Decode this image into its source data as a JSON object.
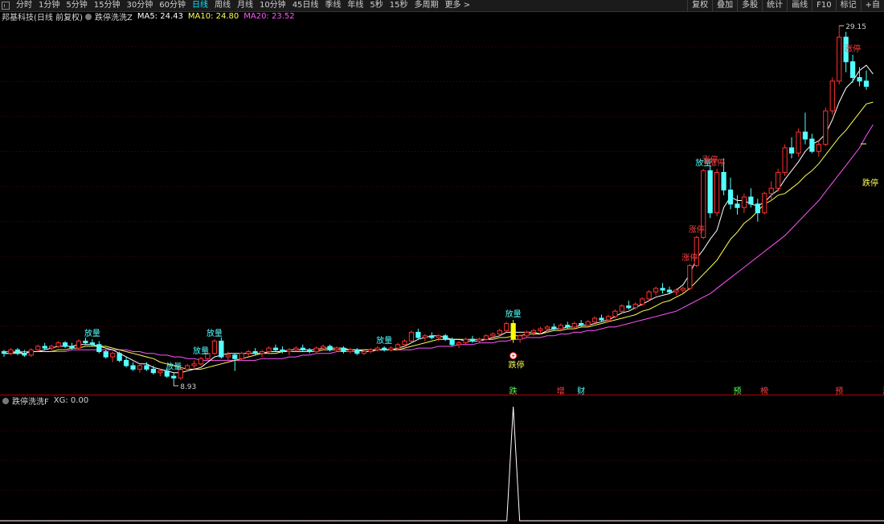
{
  "toolbar": {
    "periods": [
      "分时",
      "1分钟",
      "5分钟",
      "15分钟",
      "30分钟",
      "60分钟",
      "日线",
      "周线",
      "月线",
      "10分钟",
      "45日线",
      "季线",
      "年线",
      "5秒",
      "15秒",
      "多周期",
      "更多 >"
    ],
    "active_period": "日线",
    "right_buttons": [
      "复权",
      "叠加",
      "多股",
      "统计",
      "画线",
      "F10",
      "标记",
      "+自"
    ]
  },
  "main_legend": {
    "stock": "邦基科技(日线 前复权)",
    "indicator": "跌停洗洗Z",
    "ma5": "MA5: 24.43",
    "ma10": "MA10: 24.80",
    "ma20": "MA20: 23.52"
  },
  "sub_legend": {
    "indicator": "跌停洗洗F",
    "xg": "XG: 0.00"
  },
  "colors": {
    "up": "#ff3030",
    "down": "#54ffff",
    "ma5": "#ffffff",
    "ma10": "#ffff54",
    "ma20": "#ff54ff",
    "label_up": "#ff4040",
    "label_vol": "#54ffff",
    "label_drop": "#ffff54",
    "grid": "#5a0000"
  },
  "chart_data": {
    "type": "candlestick",
    "price_high_label": "29.15",
    "price_low_label": "8.93",
    "right_marker_text": "跌停",
    "candles": [
      [
        10.6,
        10.7,
        10.3,
        10.5
      ],
      [
        10.5,
        10.8,
        10.4,
        10.7
      ],
      [
        10.7,
        10.8,
        10.4,
        10.5
      ],
      [
        10.5,
        10.7,
        10.3,
        10.4
      ],
      [
        10.4,
        10.8,
        10.3,
        10.7
      ],
      [
        10.7,
        11.0,
        10.6,
        10.9
      ],
      [
        10.9,
        11.1,
        10.7,
        10.8
      ],
      [
        10.8,
        11.0,
        10.6,
        10.9
      ],
      [
        10.9,
        11.2,
        10.8,
        11.1
      ],
      [
        11.1,
        11.2,
        10.8,
        10.9
      ],
      [
        10.9,
        11.1,
        10.7,
        10.8
      ],
      [
        10.8,
        11.3,
        10.7,
        11.2
      ],
      [
        11.2,
        11.4,
        11.0,
        11.1
      ],
      [
        11.1,
        11.3,
        10.9,
        11.0
      ],
      [
        11.0,
        11.2,
        10.5,
        10.6
      ],
      [
        10.6,
        10.7,
        10.2,
        10.3
      ],
      [
        10.3,
        10.6,
        10.0,
        10.5
      ],
      [
        10.5,
        10.6,
        10.0,
        10.1
      ],
      [
        10.1,
        10.3,
        9.7,
        9.8
      ],
      [
        9.8,
        10.0,
        9.5,
        9.6
      ],
      [
        9.6,
        9.9,
        9.4,
        9.8
      ],
      [
        9.8,
        10.0,
        9.5,
        9.6
      ],
      [
        9.6,
        9.8,
        9.3,
        9.4
      ],
      [
        9.4,
        9.6,
        9.2,
        9.5
      ],
      [
        9.5,
        9.7,
        9.1,
        9.2
      ],
      [
        9.2,
        9.4,
        8.93,
        9.1
      ],
      [
        9.1,
        9.7,
        9.0,
        9.6
      ],
      [
        9.6,
        9.9,
        9.5,
        9.8
      ],
      [
        9.8,
        10.1,
        9.6,
        9.9
      ],
      [
        9.9,
        10.3,
        9.8,
        10.2
      ],
      [
        10.2,
        10.6,
        10.1,
        10.5
      ],
      [
        10.5,
        11.3,
        10.4,
        11.2
      ],
      [
        11.2,
        11.4,
        10.2,
        10.3
      ],
      [
        10.3,
        10.6,
        10.0,
        10.4
      ],
      [
        10.4,
        10.5,
        9.5,
        10.2
      ],
      [
        10.2,
        10.6,
        10.1,
        10.5
      ],
      [
        10.5,
        10.7,
        10.3,
        10.6
      ],
      [
        10.6,
        10.8,
        10.4,
        10.5
      ],
      [
        10.5,
        10.7,
        10.3,
        10.6
      ],
      [
        10.6,
        10.9,
        10.5,
        10.8
      ],
      [
        10.8,
        11.0,
        10.6,
        10.7
      ],
      [
        10.7,
        10.9,
        10.5,
        10.6
      ],
      [
        10.6,
        10.8,
        10.4,
        10.7
      ],
      [
        10.7,
        10.9,
        10.6,
        10.8
      ],
      [
        10.8,
        11.0,
        10.6,
        10.7
      ],
      [
        10.7,
        10.8,
        10.5,
        10.6
      ],
      [
        10.6,
        10.9,
        10.5,
        10.8
      ],
      [
        10.8,
        11.0,
        10.7,
        10.9
      ],
      [
        10.9,
        11.0,
        10.6,
        10.7
      ],
      [
        10.7,
        10.9,
        10.6,
        10.8
      ],
      [
        10.8,
        10.9,
        10.5,
        10.6
      ],
      [
        10.6,
        10.8,
        10.5,
        10.7
      ],
      [
        10.7,
        10.8,
        10.4,
        10.5
      ],
      [
        10.5,
        10.7,
        10.4,
        10.6
      ],
      [
        10.6,
        10.8,
        10.5,
        10.7
      ],
      [
        10.7,
        10.9,
        10.6,
        10.8
      ],
      [
        10.8,
        10.9,
        10.6,
        10.7
      ],
      [
        10.7,
        10.9,
        10.6,
        10.8
      ],
      [
        10.8,
        11.1,
        10.7,
        11.0
      ],
      [
        11.0,
        11.3,
        10.9,
        11.2
      ],
      [
        11.2,
        11.8,
        11.1,
        11.7
      ],
      [
        11.7,
        11.9,
        11.3,
        11.4
      ],
      [
        11.4,
        11.6,
        11.2,
        11.5
      ],
      [
        11.5,
        11.7,
        11.3,
        11.4
      ],
      [
        11.4,
        11.6,
        11.2,
        11.5
      ],
      [
        11.5,
        11.6,
        11.2,
        11.3
      ],
      [
        11.3,
        11.4,
        10.9,
        11.0
      ],
      [
        11.0,
        11.2,
        10.8,
        11.1
      ],
      [
        11.1,
        11.4,
        11.0,
        11.3
      ],
      [
        11.3,
        11.5,
        11.1,
        11.2
      ],
      [
        11.2,
        11.4,
        11.1,
        11.3
      ],
      [
        11.3,
        11.6,
        11.2,
        11.5
      ],
      [
        11.5,
        11.7,
        11.3,
        11.6
      ],
      [
        11.6,
        11.9,
        11.5,
        11.8
      ],
      [
        11.8,
        12.3,
        11.7,
        12.2
      ],
      [
        12.2,
        12.4,
        11.1,
        11.3
      ],
      [
        11.3,
        11.6,
        11.1,
        11.5
      ],
      [
        11.5,
        11.8,
        11.4,
        11.7
      ],
      [
        11.7,
        11.9,
        11.5,
        11.8
      ],
      [
        11.8,
        12.0,
        11.6,
        11.9
      ],
      [
        11.9,
        12.1,
        11.7,
        12.0
      ],
      [
        12.0,
        12.2,
        11.8,
        11.9
      ],
      [
        11.9,
        12.2,
        11.8,
        12.1
      ],
      [
        12.1,
        12.3,
        11.9,
        12.0
      ],
      [
        12.0,
        12.3,
        11.9,
        12.2
      ],
      [
        12.2,
        12.4,
        12.0,
        12.1
      ],
      [
        12.1,
        12.4,
        12.0,
        12.3
      ],
      [
        12.3,
        12.6,
        12.2,
        12.5
      ],
      [
        12.5,
        12.7,
        12.3,
        12.4
      ],
      [
        12.4,
        12.7,
        12.3,
        12.6
      ],
      [
        12.6,
        13.0,
        12.5,
        12.9
      ],
      [
        12.9,
        13.3,
        12.8,
        13.2
      ],
      [
        13.2,
        13.5,
        13.0,
        13.1
      ],
      [
        13.1,
        13.4,
        13.0,
        13.3
      ],
      [
        13.3,
        13.7,
        13.2,
        13.6
      ],
      [
        13.6,
        14.1,
        13.5,
        14.0
      ],
      [
        14.0,
        14.3,
        13.8,
        14.2
      ],
      [
        14.2,
        14.5,
        13.9,
        14.1
      ],
      [
        14.1,
        14.3,
        13.9,
        14.0
      ],
      [
        14.0,
        14.2,
        13.8,
        14.1
      ],
      [
        14.1,
        14.3,
        13.9,
        14.2
      ],
      [
        14.2,
        15.6,
        14.1,
        15.5
      ],
      [
        15.5,
        17.2,
        15.4,
        17.1
      ],
      [
        17.1,
        21.0,
        17.0,
        20.9
      ],
      [
        20.9,
        21.2,
        18.2,
        18.5
      ],
      [
        18.5,
        21.0,
        18.3,
        20.8
      ],
      [
        20.8,
        21.6,
        19.5,
        19.8
      ],
      [
        19.8,
        20.5,
        18.7,
        19.0
      ],
      [
        19.0,
        19.5,
        18.4,
        18.8
      ],
      [
        18.8,
        19.6,
        18.5,
        19.4
      ],
      [
        19.4,
        19.9,
        18.8,
        19.0
      ],
      [
        19.0,
        19.3,
        18.0,
        18.5
      ],
      [
        18.5,
        19.7,
        18.4,
        19.6
      ],
      [
        19.6,
        20.3,
        19.2,
        19.9
      ],
      [
        19.9,
        21.0,
        19.7,
        20.8
      ],
      [
        20.8,
        22.4,
        20.6,
        22.2
      ],
      [
        22.2,
        22.8,
        21.6,
        21.9
      ],
      [
        21.9,
        23.3,
        21.7,
        23.1
      ],
      [
        23.1,
        24.2,
        22.4,
        22.7
      ],
      [
        22.7,
        23.0,
        21.9,
        22.0
      ],
      [
        22.0,
        22.6,
        21.7,
        22.4
      ],
      [
        22.4,
        24.5,
        22.3,
        24.3
      ],
      [
        24.3,
        26.2,
        24.1,
        26.0
      ],
      [
        26.0,
        29.15,
        25.8,
        28.5
      ],
      [
        28.5,
        28.8,
        26.5,
        27.1
      ],
      [
        27.1,
        27.5,
        25.9,
        26.2
      ],
      [
        26.2,
        26.8,
        25.7,
        26.0
      ],
      [
        26.0,
        26.6,
        25.5,
        25.7
      ]
    ],
    "ma5": [
      10.5,
      10.5,
      10.6,
      10.5,
      10.6,
      10.6,
      10.7,
      10.8,
      10.9,
      10.9,
      10.9,
      11.0,
      11.0,
      11.0,
      10.9,
      10.8,
      10.7,
      10.5,
      10.3,
      10.1,
      9.9,
      9.9,
      9.7,
      9.6,
      9.5,
      9.4,
      9.4,
      9.5,
      9.6,
      9.7,
      10.0,
      10.3,
      10.4,
      10.5,
      10.5,
      10.5,
      10.5,
      10.5,
      10.5,
      10.6,
      10.6,
      10.6,
      10.7,
      10.7,
      10.7,
      10.7,
      10.7,
      10.8,
      10.8,
      10.8,
      10.8,
      10.7,
      10.7,
      10.6,
      10.6,
      10.7,
      10.7,
      10.7,
      10.8,
      10.9,
      11.1,
      11.3,
      11.4,
      11.5,
      11.5,
      11.4,
      11.3,
      11.3,
      11.2,
      11.2,
      11.2,
      11.3,
      11.4,
      11.5,
      11.7,
      11.7,
      11.7,
      11.7,
      11.7,
      11.6,
      11.8,
      11.9,
      11.9,
      12.0,
      12.0,
      12.1,
      12.1,
      12.2,
      12.3,
      12.4,
      12.6,
      12.8,
      12.9,
      13.1,
      13.3,
      13.5,
      13.7,
      13.8,
      13.9,
      14.1,
      14.4,
      15.0,
      15.9,
      16.4,
      17.0,
      17.5,
      18.8,
      19.4,
      19.2,
      19.2,
      19.0,
      18.9,
      19.1,
      19.5,
      19.8,
      20.4,
      20.9,
      21.4,
      22.0,
      22.4,
      22.6,
      23.0,
      23.8,
      24.8,
      25.6,
      26.0,
      26.6,
      26.9,
      26.4
    ],
    "ma10": [
      10.5,
      10.5,
      10.5,
      10.5,
      10.6,
      10.6,
      10.6,
      10.6,
      10.7,
      10.7,
      10.8,
      10.8,
      10.9,
      10.9,
      10.9,
      10.9,
      10.8,
      10.7,
      10.6,
      10.5,
      10.4,
      10.3,
      10.2,
      10.0,
      9.9,
      9.8,
      9.7,
      9.6,
      9.6,
      9.6,
      9.7,
      9.8,
      9.9,
      10.0,
      10.1,
      10.2,
      10.3,
      10.4,
      10.5,
      10.5,
      10.5,
      10.6,
      10.6,
      10.6,
      10.6,
      10.6,
      10.6,
      10.7,
      10.7,
      10.7,
      10.7,
      10.7,
      10.7,
      10.7,
      10.7,
      10.7,
      10.7,
      10.7,
      10.7,
      10.8,
      10.9,
      11.0,
      11.1,
      11.2,
      11.3,
      11.3,
      11.3,
      11.3,
      11.3,
      11.3,
      11.3,
      11.3,
      11.3,
      11.4,
      11.4,
      11.5,
      11.5,
      11.6,
      11.6,
      11.6,
      11.7,
      11.8,
      11.8,
      11.9,
      11.9,
      12.0,
      12.0,
      12.1,
      12.2,
      12.3,
      12.4,
      12.5,
      12.6,
      12.7,
      12.9,
      13.0,
      13.2,
      13.4,
      13.5,
      13.7,
      13.9,
      14.2,
      14.6,
      15.0,
      15.4,
      15.8,
      16.4,
      17.0,
      17.4,
      17.9,
      18.2,
      18.6,
      19.0,
      19.2,
      19.5,
      19.6,
      19.9,
      20.2,
      20.6,
      20.9,
      21.3,
      21.8,
      22.3,
      22.8,
      23.2,
      23.7,
      24.2,
      24.7,
      24.8
    ],
    "ma20": [
      10.6,
      10.6,
      10.6,
      10.6,
      10.6,
      10.6,
      10.6,
      10.6,
      10.6,
      10.6,
      10.7,
      10.7,
      10.7,
      10.7,
      10.7,
      10.7,
      10.7,
      10.7,
      10.7,
      10.6,
      10.6,
      10.5,
      10.5,
      10.4,
      10.4,
      10.3,
      10.3,
      10.2,
      10.2,
      10.1,
      10.1,
      10.1,
      10.1,
      10.1,
      10.1,
      10.1,
      10.1,
      10.1,
      10.2,
      10.2,
      10.2,
      10.2,
      10.3,
      10.3,
      10.4,
      10.4,
      10.5,
      10.5,
      10.5,
      10.6,
      10.6,
      10.6,
      10.6,
      10.7,
      10.7,
      10.7,
      10.7,
      10.7,
      10.7,
      10.7,
      10.7,
      10.8,
      10.8,
      10.8,
      10.9,
      10.9,
      10.9,
      11.0,
      11.0,
      11.0,
      11.1,
      11.1,
      11.1,
      11.2,
      11.2,
      11.3,
      11.3,
      11.4,
      11.4,
      11.4,
      11.5,
      11.5,
      11.6,
      11.6,
      11.7,
      11.7,
      11.8,
      11.8,
      11.9,
      12.0,
      12.0,
      12.1,
      12.2,
      12.3,
      12.4,
      12.5,
      12.6,
      12.7,
      12.8,
      12.9,
      13.1,
      13.3,
      13.5,
      13.7,
      13.9,
      14.2,
      14.5,
      14.8,
      15.1,
      15.4,
      15.7,
      16.0,
      16.3,
      16.6,
      16.9,
      17.2,
      17.6,
      18.0,
      18.4,
      18.8,
      19.2,
      19.7,
      20.2,
      20.7,
      21.2,
      21.7,
      22.2,
      22.9,
      23.52
    ],
    "labels_above": [
      {
        "i": 13,
        "text": "放量",
        "kind": "vol"
      },
      {
        "i": 25,
        "text": "放量",
        "kind": "vol"
      },
      {
        "i": 29,
        "text": "放量",
        "kind": "vol"
      },
      {
        "i": 31,
        "text": "放量",
        "kind": "vol"
      },
      {
        "i": 56,
        "text": "放量",
        "kind": "vol"
      },
      {
        "i": 75,
        "text": "放量",
        "kind": "vol"
      },
      {
        "i": 101,
        "text": "涨停",
        "kind": "up"
      },
      {
        "i": 102,
        "text": "涨停",
        "kind": "up"
      },
      {
        "i": 103,
        "text": "放量",
        "kind": "vol"
      },
      {
        "i": 104,
        "text": "涨停",
        "kind": "up"
      },
      {
        "i": 105,
        "text": "涨停",
        "kind": "up"
      },
      {
        "i": 125,
        "text": "涨停",
        "kind": "up"
      }
    ],
    "drop_signal": {
      "i": 75,
      "text": "跌停"
    },
    "bottom_markers": [
      {
        "i": 75,
        "text": "跌",
        "color": "#54ff54"
      },
      {
        "i": 82,
        "text": "增",
        "color": "#ff4040"
      },
      {
        "i": 85,
        "text": "财",
        "color": "#54ffff"
      },
      {
        "i": 108,
        "text": "预",
        "color": "#54ff54"
      },
      {
        "i": 112,
        "text": "榜",
        "color": "#ff4040"
      },
      {
        "i": 123,
        "text": "预",
        "color": "#ff4040"
      },
      {
        "i": 130,
        "text": "涨",
        "color": "#ff4040"
      }
    ],
    "sub_peak_i": 75,
    "xg_values_note": ""
  }
}
